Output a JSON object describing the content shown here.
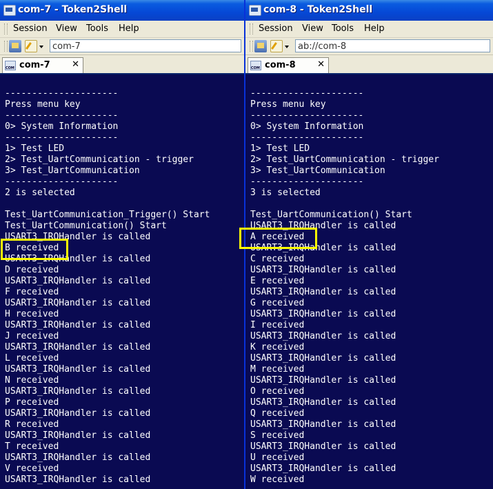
{
  "left_window": {
    "title": "com-7 - Token2Shell",
    "menu": [
      "Session",
      "View",
      "Tools",
      "Help"
    ],
    "address": "com-7",
    "tab_label": "com-7",
    "tab_close": "✕",
    "terminal_lines": [
      "---------------------",
      "Press menu key",
      "---------------------",
      "0> System Information",
      "---------------------",
      "1> Test LED",
      "2> Test_UartCommunication - trigger",
      "3> Test_UartCommunication",
      "---------------------",
      "2 is selected",
      "",
      "Test_UartCommunication_Trigger() Start",
      "Test_UartCommunication() Start",
      "USART3_IRQHandler is called",
      "B received",
      "USART3_IRQHandler is called",
      "D received",
      "USART3_IRQHandler is called",
      "F received",
      "USART3_IRQHandler is called",
      "H received",
      "USART3_IRQHandler is called",
      "J received",
      "USART3_IRQHandler is called",
      "L received",
      "USART3_IRQHandler is called",
      "N received",
      "USART3_IRQHandler is called",
      "P received",
      "USART3_IRQHandler is called",
      "R received",
      "USART3_IRQHandler is called",
      "T received",
      "USART3_IRQHandler is called",
      "V received",
      "USART3_IRQHandler is called"
    ]
  },
  "right_window": {
    "title": "com-8 - Token2Shell",
    "menu": [
      "Session",
      "View",
      "Tools",
      "Help"
    ],
    "address": "ab://com-8",
    "tab_label": "com-8",
    "tab_close": "✕",
    "terminal_lines": [
      "---------------------",
      "Press menu key",
      "---------------------",
      "0> System Information",
      "---------------------",
      "1> Test LED",
      "2> Test_UartCommunication - trigger",
      "3> Test_UartCommunication",
      "---------------------",
      "3 is selected",
      "",
      "Test_UartCommunication() Start",
      "USART3_IRQHandler is called",
      "A received",
      "USART3_IRQHandler is called",
      "C received",
      "USART3_IRQHandler is called",
      "E received",
      "USART3_IRQHandler is called",
      "G received",
      "USART3_IRQHandler is called",
      "I received",
      "USART3_IRQHandler is called",
      "K received",
      "USART3_IRQHandler is called",
      "M received",
      "USART3_IRQHandler is called",
      "O received",
      "USART3_IRQHandler is called",
      "Q received",
      "USART3_IRQHandler is called",
      "S received",
      "USART3_IRQHandler is called",
      "U received",
      "USART3_IRQHandler is called",
      "W received"
    ]
  },
  "colors": {
    "terminal_bg": "#0a0a52",
    "terminal_fg": "#ffffff",
    "highlight": "#ffff00",
    "titlebar": "#0548d6"
  }
}
